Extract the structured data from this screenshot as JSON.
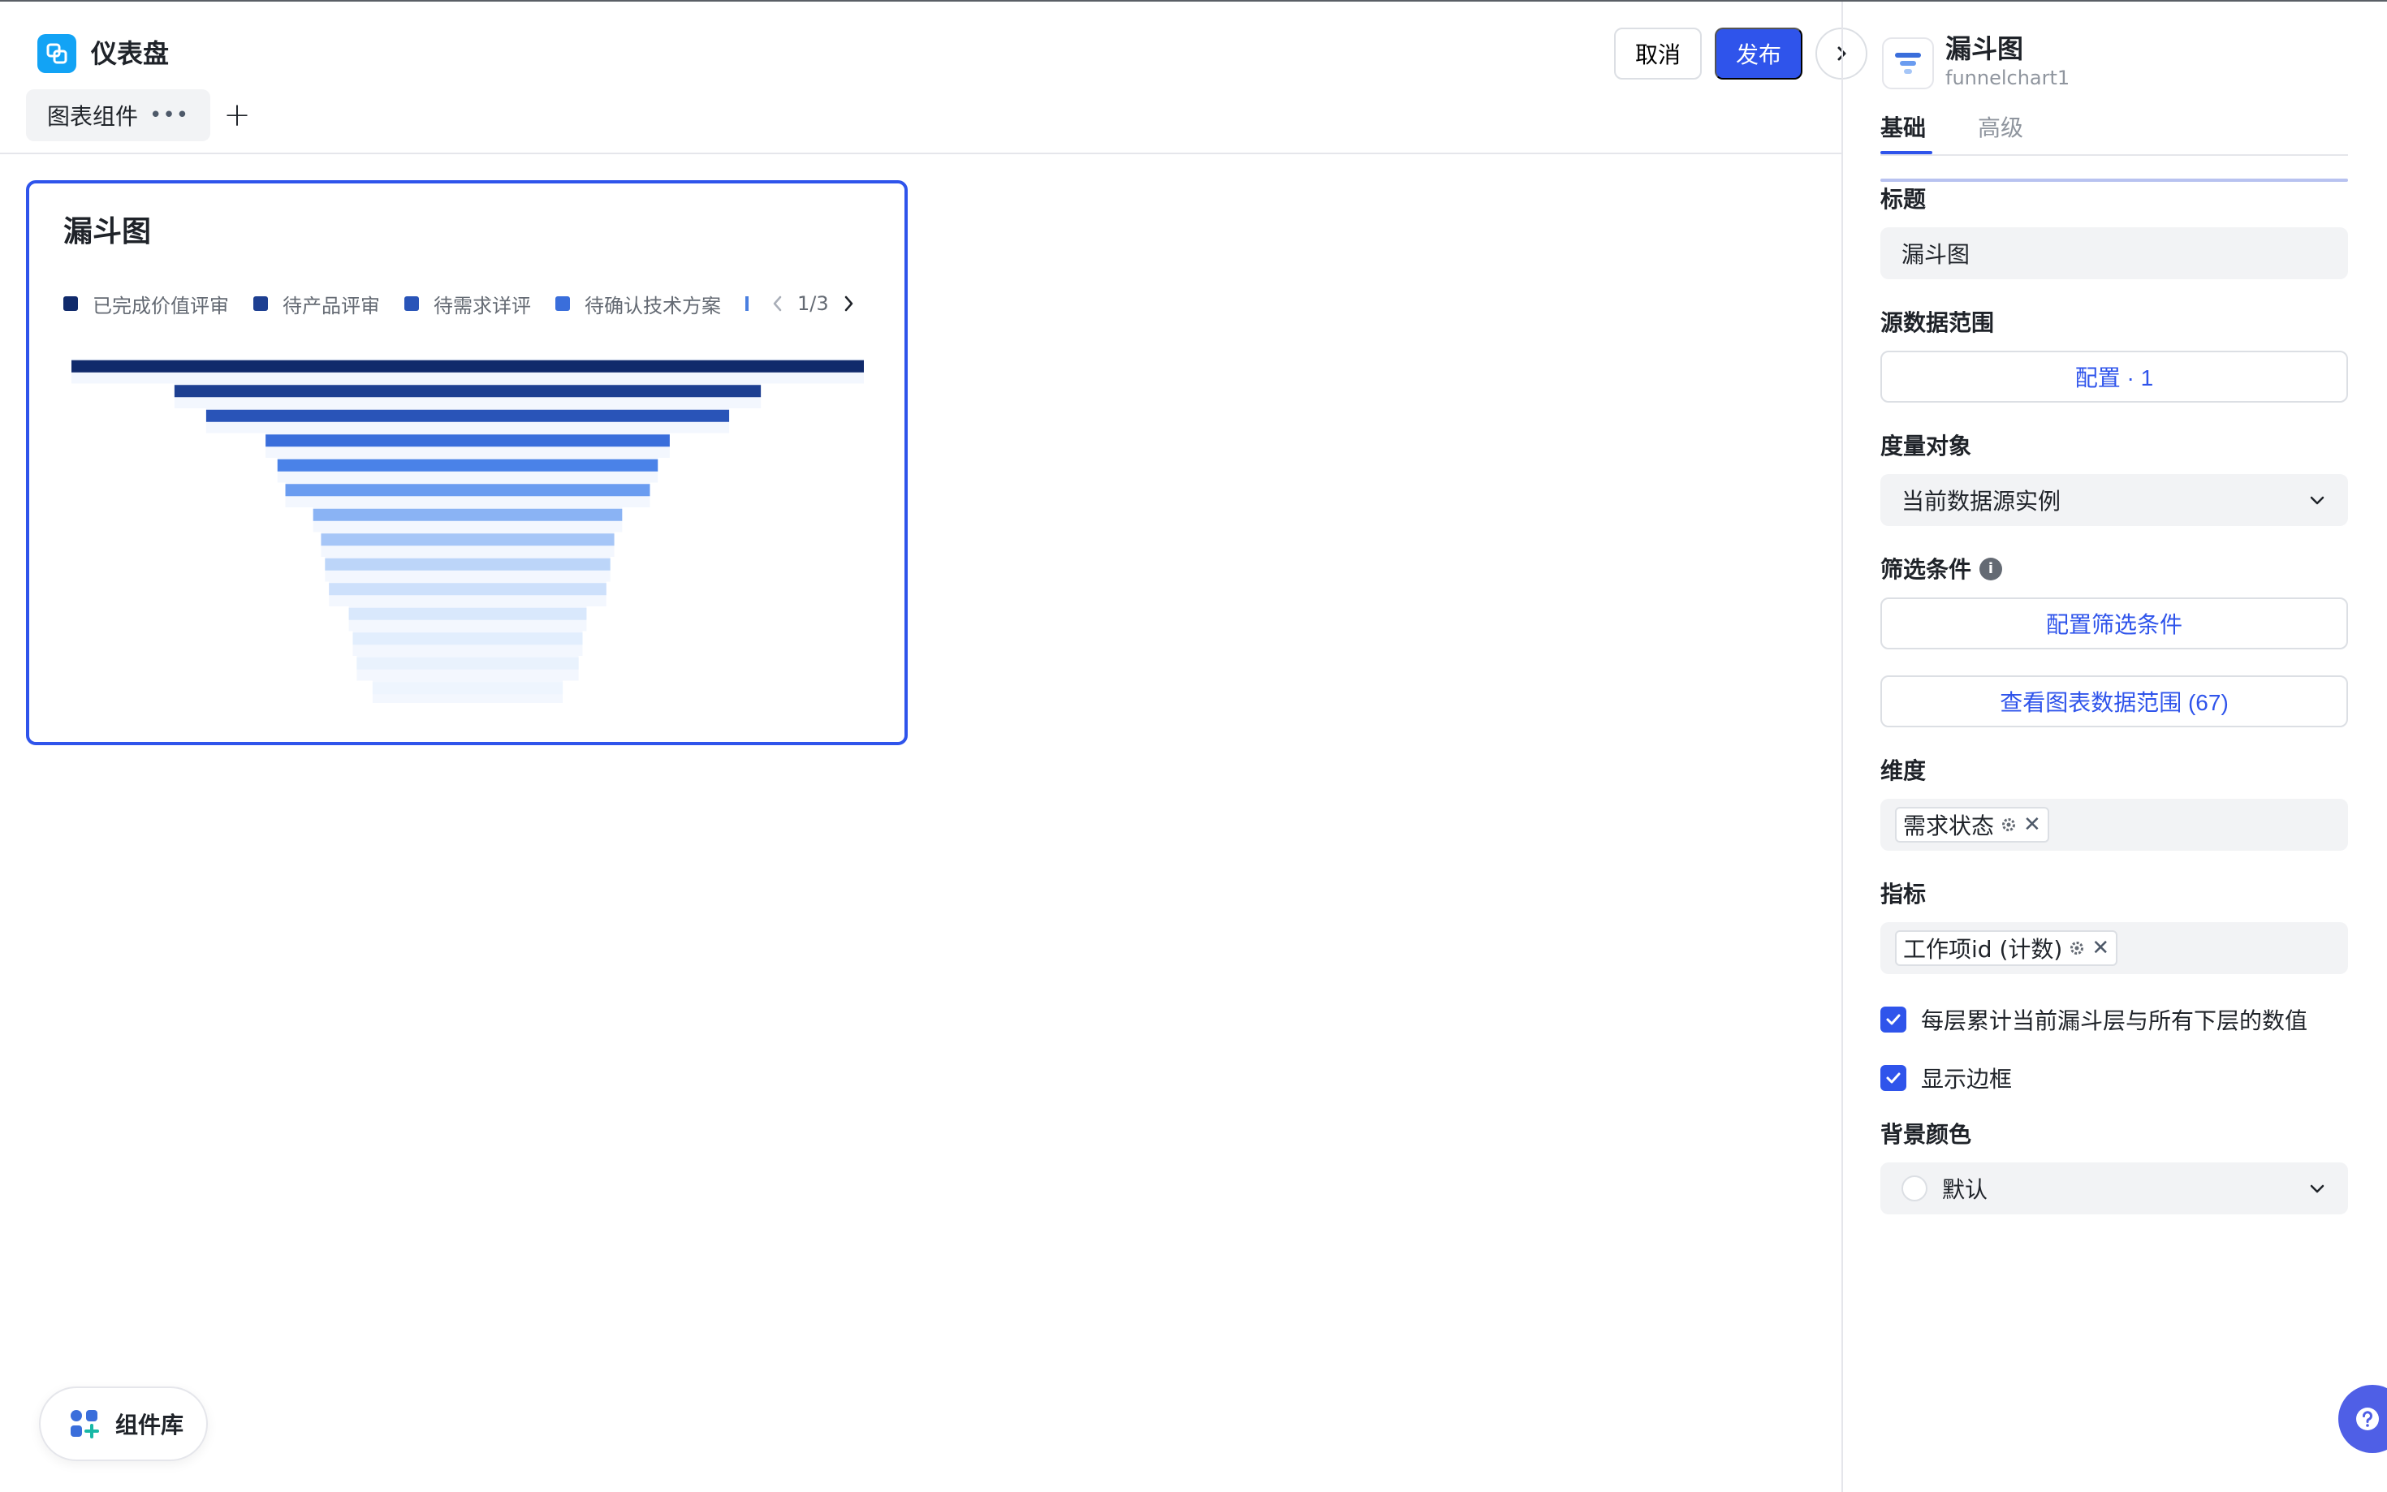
{
  "app": {
    "title": "仪表盘",
    "tab": "图表组件",
    "tab_more": "•••",
    "add_tab": "+"
  },
  "header": {
    "cancel": "取消",
    "publish": "发布"
  },
  "card": {
    "title": "漏斗图",
    "legend": [
      {
        "label": "已完成价值评审",
        "color": "#102a6b"
      },
      {
        "label": "待产品评审",
        "color": "#1d3f91"
      },
      {
        "label": "待需求详评",
        "color": "#2954b8"
      },
      {
        "label": "待确认技术方案",
        "color": "#3a6edb"
      }
    ],
    "legend_page": "1/3"
  },
  "chart_data": {
    "type": "funnel",
    "title": "漏斗图",
    "categories": [
      "已完成价值评审",
      "待产品评审",
      "待需求详评",
      "待确认技术方案",
      "",
      "",
      "",
      "",
      "",
      "",
      "",
      "",
      "",
      "",
      ""
    ],
    "values": [
      100,
      74,
      66,
      51,
      48,
      46,
      39,
      37,
      36,
      35,
      30,
      29,
      28,
      24,
      18
    ],
    "colors": [
      "#102a6b",
      "#1d3f91",
      "#2954b8",
      "#3a6edb",
      "#4a82e8",
      "#6a9cf0",
      "#8ab3f4",
      "#a6c6f7",
      "#bcd5f9",
      "#cde0fb",
      "#d9e8fc",
      "#e2eefd",
      "#e9f2fd",
      "#eef5fe",
      "#f2f7fe"
    ]
  },
  "panel": {
    "title": "漏斗图",
    "subtitle": "funnelchart1",
    "tabs": {
      "basic": "基础",
      "advanced": "高级"
    },
    "title_label": "标题",
    "title_value": "漏斗图",
    "source_label": "源数据范围",
    "source_button": "配置 · 1",
    "measure_label": "度量对象",
    "measure_value": "当前数据源实例",
    "filter_label": "筛选条件",
    "filter_button": "配置筛选条件",
    "view_button": "查看图表数据范围 (67)",
    "dimension_label": "维度",
    "dimension_chip": "需求状态",
    "metric_label": "指标",
    "metric_chip": "工作项id (计数)",
    "check1": "每层累计当前漏斗层与所有下层的数值",
    "check2": "显示边框",
    "bg_label": "背景颜色",
    "bg_value": "默认"
  },
  "bottom": {
    "component_library": "组件库"
  },
  "colors": {
    "accent": "#2f54eb",
    "logo": "#12a3f5"
  }
}
